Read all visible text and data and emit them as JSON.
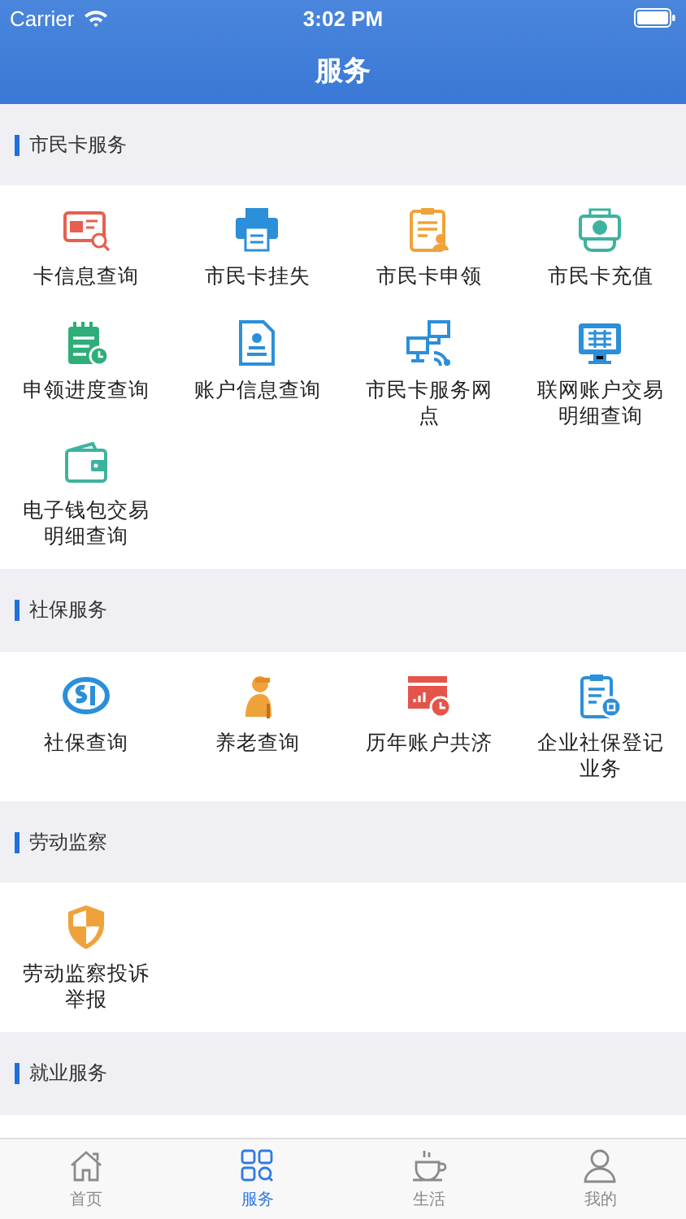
{
  "status_bar": {
    "carrier": "Carrier",
    "time": "3:02 PM"
  },
  "nav": {
    "title": "服务"
  },
  "sections": [
    {
      "title": "市民卡服务",
      "items": [
        {
          "label": "卡信息查询",
          "kind": "card-search"
        },
        {
          "label": "市民卡挂失",
          "kind": "printer"
        },
        {
          "label": "市民卡申领",
          "kind": "clipboard-person"
        },
        {
          "label": "市民卡充值",
          "kind": "money"
        },
        {
          "label": "申领进度查询",
          "kind": "calendar-clock"
        },
        {
          "label": "账户信息查询",
          "kind": "document-person"
        },
        {
          "label": "市民卡服务网点",
          "kind": "network"
        },
        {
          "label": "联网账户交易明细查询",
          "kind": "monitor"
        },
        {
          "label": "电子钱包交易明细查询",
          "kind": "wallet"
        }
      ]
    },
    {
      "title": "社保服务",
      "items": [
        {
          "label": "社保查询",
          "kind": "si-logo"
        },
        {
          "label": "养老查询",
          "kind": "elder"
        },
        {
          "label": "历年账户共济",
          "kind": "chart-clock"
        },
        {
          "label": "企业社保登记业务",
          "kind": "clipboard-badge"
        }
      ]
    },
    {
      "title": "劳动监察",
      "items": [
        {
          "label": "劳动监察投诉举报",
          "kind": "shield"
        }
      ]
    },
    {
      "title": "就业服务"
    }
  ],
  "tabs": [
    {
      "label": "首页",
      "kind": "home",
      "selected": false
    },
    {
      "label": "服务",
      "kind": "grid",
      "selected": true
    },
    {
      "label": "生活",
      "kind": "cup",
      "selected": false
    },
    {
      "label": "我的",
      "kind": "person",
      "selected": false
    }
  ]
}
